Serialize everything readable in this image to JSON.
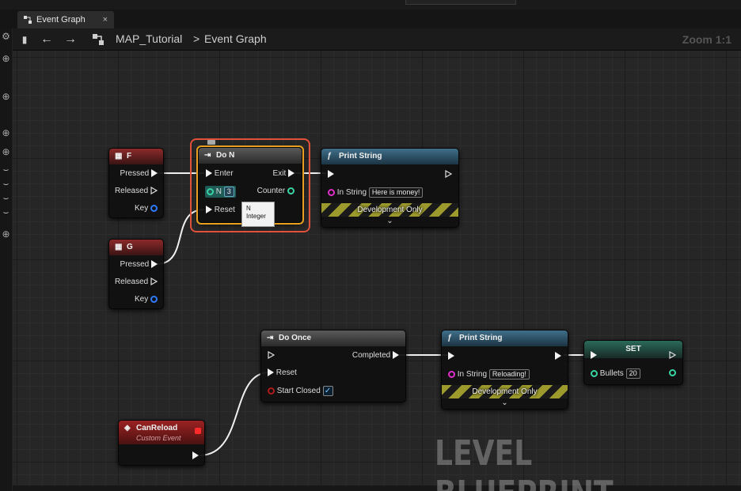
{
  "tab": {
    "title": "Event Graph",
    "close": "×"
  },
  "breadcrumb": {
    "map": "MAP_Tutorial",
    "separator": ">",
    "graph": "Event Graph"
  },
  "zoom": "Zoom 1:1",
  "nodes": {
    "f_key": {
      "title": "F",
      "pins": {
        "pressed": "Pressed",
        "released": "Released",
        "key": "Key"
      }
    },
    "g_key": {
      "title": "G",
      "pins": {
        "pressed": "Pressed",
        "released": "Released",
        "key": "Key"
      }
    },
    "do_n": {
      "title": "Do N",
      "pins": {
        "enter": "Enter",
        "exit": "Exit",
        "n": "N",
        "n_value": "3",
        "counter": "Counter",
        "reset": "Reset"
      }
    },
    "tooltip": {
      "line1": "N",
      "line2": "Integer"
    },
    "print1": {
      "title": "Print String",
      "in_string_label": "In String",
      "in_string_value": "Here is money!",
      "dev": "Development Only",
      "chevron": "⌄"
    },
    "do_once": {
      "title": "Do Once",
      "pins": {
        "completed": "Completed",
        "reset": "Reset",
        "start_closed": "Start Closed"
      },
      "start_closed_checked": true,
      "check_glyph": "✓"
    },
    "print2": {
      "title": "Print String",
      "in_string_label": "In String",
      "in_string_value": "Reloading!",
      "dev": "Development Only",
      "chevron": "⌄"
    },
    "set": {
      "title": "SET",
      "var_label": "Bullets",
      "var_value": "20"
    },
    "can_reload": {
      "title": "CanReload",
      "subtitle": "Custom Event"
    }
  },
  "watermark": "LEVEL BLUEPRINT",
  "colors": {
    "exec": "#f2f2f2",
    "integer": "#39d4a4",
    "string": "#e02ec8",
    "struct": "#2f7bff",
    "bool": "#b01a1a",
    "selection": "#e0513a"
  },
  "icons": {
    "tab": "graph-icon",
    "back": "back-arrow-icon",
    "forward": "forward-arrow-icon",
    "graph": "graph-icon",
    "function": "function-icon",
    "flow": "flow-control-icon",
    "key": "keyboard-key-icon",
    "event": "event-icon"
  }
}
